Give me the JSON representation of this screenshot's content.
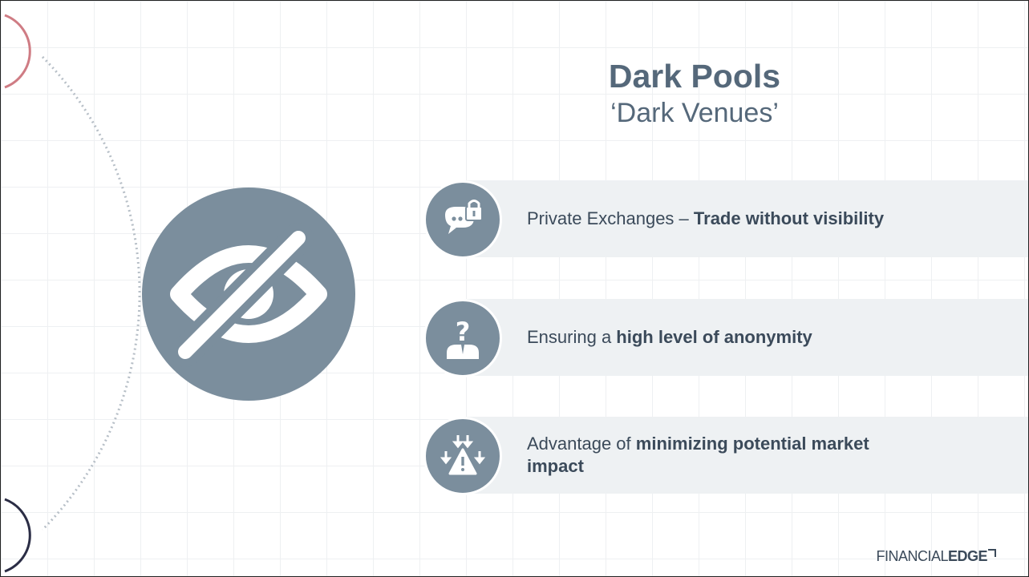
{
  "slide": {
    "title": "Dark Pools",
    "subtitle": "‘Dark Venues’",
    "colors": {
      "accent": "#7b8e9d",
      "text": "#3b4a5a",
      "title": "#55687a",
      "panel": "#eef1f3",
      "top_arc": "#cf7c84",
      "bottom_arc": "#2b2d45"
    },
    "hero_icon": "eye-slash-icon",
    "points": [
      {
        "icon": "chat-lock-icon",
        "text": "Private Exchanges – ",
        "bold": "Trade without visibility",
        "text_after": ""
      },
      {
        "icon": "anonymous-person-icon",
        "text": "Ensuring a ",
        "bold": "high level of anonymity",
        "text_after": ""
      },
      {
        "icon": "market-impact-warning-icon",
        "text": "Advantage of ",
        "bold": "minimizing potential market impact",
        "text_after": ""
      }
    ]
  },
  "logo": {
    "prefix": "FINANCIAL",
    "bold": "EDGE"
  }
}
